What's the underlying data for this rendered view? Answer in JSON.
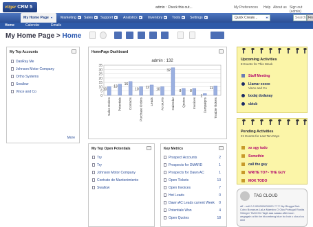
{
  "app": {
    "logo": "vtiger",
    "logo_suffix": "CRM 5"
  },
  "topbar": {
    "admin_notice": "admin : Check this out...",
    "links": [
      "My Preferences",
      "Help",
      "About us",
      "Sign out (admin)"
    ]
  },
  "nav": {
    "tabs": [
      "My Home Page",
      "Marketing",
      "Sales",
      "Support",
      "Analytics",
      "Inventory",
      "Tools",
      "Settings"
    ],
    "active": "My Home Page",
    "quick_create": "Quick Create...",
    "search_placeholder": "Search...",
    "find_label": "Find"
  },
  "subnav": {
    "items": [
      "Home",
      "Calendar",
      "Emails"
    ]
  },
  "page": {
    "title_prefix": "My Home Page",
    "title_sep": ">",
    "title_current": "Home"
  },
  "top_accounts": {
    "title": "My Top Accounts",
    "items": [
      "DanRay Me",
      "Johnson Motor Company",
      "Ortho Systems",
      "Swallow",
      "Vince and Co"
    ],
    "more": "More"
  },
  "chart_panel": {
    "title": "HomePage Dashboard"
  },
  "chart_data": {
    "type": "bar",
    "title": "admin : 132",
    "categories": [
      "Sales Orders",
      "Potentials",
      "Contacts",
      "Purchase Orders",
      "Leads",
      "Accounts",
      "Calendar",
      "Quotes",
      "Invoices",
      "Campaigns",
      "Trouble Tickets"
    ],
    "values": [
      10,
      13,
      16,
      10,
      12,
      10,
      32,
      8,
      8,
      2,
      11
    ],
    "ylim": [
      0,
      35
    ],
    "yticks": [
      0,
      5,
      10,
      15,
      20,
      25,
      30,
      35
    ],
    "bar_color": "#9bb0e0",
    "grid": true
  },
  "open_potentials": {
    "title": "My Top Open Potentials",
    "items": [
      "Try",
      "Try",
      "Johnson Motor Company",
      "Contrato de Mantenimiento",
      "Swallow"
    ]
  },
  "key_metrics": {
    "title": "Key Metrics",
    "rows": [
      {
        "label": "Prospect Accounts",
        "value": "2"
      },
      {
        "label": "Prospects for DMARD",
        "value": "1"
      },
      {
        "label": "Prospects for Dawn AC",
        "value": "1"
      },
      {
        "label": "Open Tickets",
        "value": "13"
      },
      {
        "label": "Open Invoices",
        "value": "7"
      },
      {
        "label": "Hot Leads",
        "value": "0"
      },
      {
        "label": "Dawn AC Leads current Week",
        "value": "0"
      },
      {
        "label": "Potentials Won",
        "value": "4"
      },
      {
        "label": "Open Quotes",
        "value": "18"
      }
    ]
  },
  "upcoming": {
    "title": "Upcoming Activities",
    "subtitle": "8 Events for This Week",
    "events": [
      {
        "title": "Staff Meeting",
        "sub": "",
        "color": "#b0006b"
      },
      {
        "title": "Llamar xxxxx",
        "sub": "Vince and Co",
        "color": "#1a2a66"
      },
      {
        "title": "bodaj dodanay",
        "sub": "",
        "color": "#1a2a66"
      },
      {
        "title": "cbtcb",
        "sub": "",
        "color": "#1a2a66"
      }
    ]
  },
  "pending": {
    "title": "Pending Activities",
    "subtitle": "21 Events for Last Ten Days",
    "items": [
      {
        "title": "xx sgy todo",
        "color": "#b0006b"
      },
      {
        "title": "Somethin",
        "color": "#b0006b"
      },
      {
        "title": "call the guy",
        "color": "#1a2a66"
      },
      {
        "title": "WRITE TO?~ THE GUY",
        "color": "#b0006b"
      },
      {
        "title": "MOK TODO",
        "color": "#b0006b"
      }
    ]
  },
  "tag_cloud": {
    "title": "TAG CLOUD",
    "text": "aff - null 0.0 000000000000 ???? lky Blogga Bob Cobo Bonanza LaLa Maestro O Oka Portugal Rosita Stringer TAGCH4 Tagit aaa aaaaa afternoon aegagain at bb be bloomberg blue bo bob c cloud cu ddd"
  }
}
